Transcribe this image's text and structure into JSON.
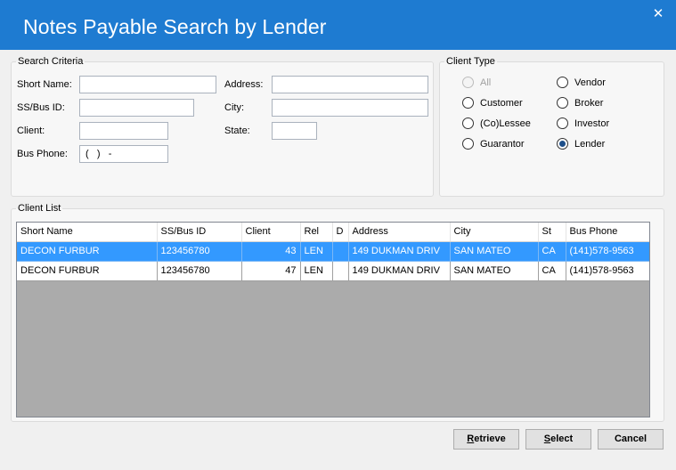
{
  "window": {
    "title": "Notes Payable Search by Lender",
    "close_glyph": "✕"
  },
  "search_criteria": {
    "legend": "Search Criteria",
    "short_name_label": "Short Name:",
    "address_label": "Address:",
    "ss_bus_id_label": "SS/Bus ID:",
    "city_label": "City:",
    "client_label": "Client:",
    "state_label": "State:",
    "bus_phone_label": "Bus Phone:",
    "short_name_value": "",
    "address_value": "",
    "ss_bus_id_value": "",
    "city_value": "",
    "client_value": "",
    "state_value": "",
    "bus_phone_value": " (   )   -"
  },
  "client_type": {
    "legend": "Client Type",
    "options": [
      {
        "label": "All",
        "checked": false,
        "disabled": true
      },
      {
        "label": "Vendor",
        "checked": false,
        "disabled": false
      },
      {
        "label": "Customer",
        "checked": false,
        "disabled": false
      },
      {
        "label": "Broker",
        "checked": false,
        "disabled": false
      },
      {
        "label": "(Co)Lessee",
        "checked": false,
        "disabled": false
      },
      {
        "label": "Investor",
        "checked": false,
        "disabled": false
      },
      {
        "label": "Guarantor",
        "checked": false,
        "disabled": false
      },
      {
        "label": "Lender",
        "checked": true,
        "disabled": false
      }
    ]
  },
  "client_list": {
    "legend": "Client List",
    "columns": [
      "Short Name",
      "SS/Bus ID",
      "Client",
      "Rel",
      "D",
      "Address",
      "City",
      "St",
      "Bus Phone"
    ],
    "rows": [
      [
        "DECON FURBUR",
        "123456780",
        "43",
        "LEN",
        "",
        "149 DUKMAN DRIV",
        "SAN MATEO",
        "CA",
        "(141)578-9563"
      ],
      [
        "DECON FURBUR",
        "123456780",
        "47",
        "LEN",
        "",
        "149 DUKMAN DRIV",
        "SAN MATEO",
        "CA",
        "(141)578-9563"
      ]
    ],
    "selected_row": 0
  },
  "buttons": {
    "retrieve": {
      "accel": "R",
      "rest": "etrieve"
    },
    "select": {
      "accel": "S",
      "rest": "elect"
    },
    "cancel": {
      "label": "Cancel"
    }
  }
}
